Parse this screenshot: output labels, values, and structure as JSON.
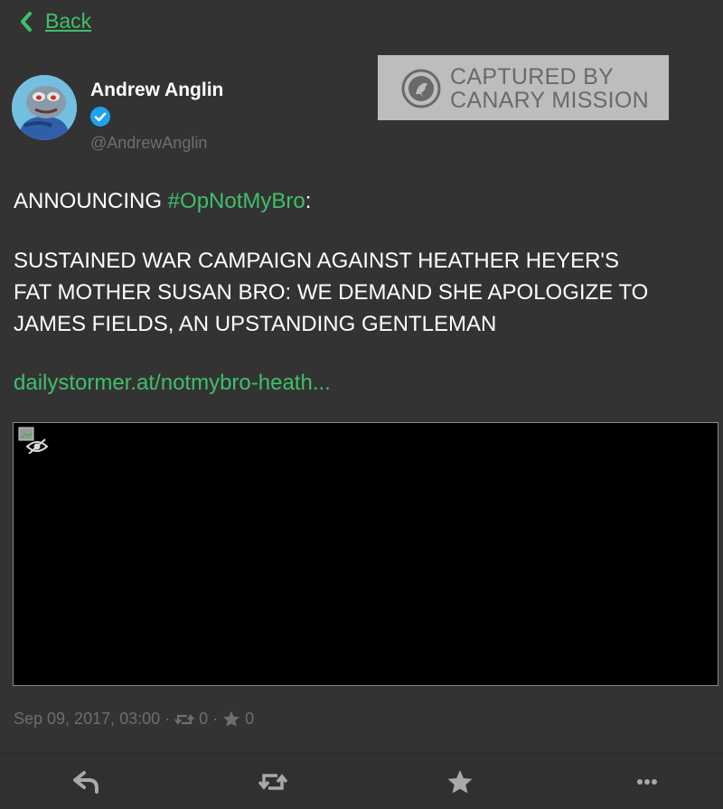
{
  "nav": {
    "back_label": "Back"
  },
  "author": {
    "name": "Andrew Anglin",
    "handle": "@AndrewAnglin",
    "verified": true
  },
  "watermark": {
    "line1": "CAPTURED BY",
    "line2": "CANARY MISSION"
  },
  "tweet": {
    "line1_prefix": "ANNOUNCING ",
    "line1_hashtag": "#OpNotMyBro",
    "line1_suffix": ":",
    "body_lines": [
      "SUSTAINED WAR CAMPAIGN AGAINST HEATHER HEYER'S",
      "FAT MOTHER SUSAN BRO: WE DEMAND SHE APOLOGIZE TO",
      "JAMES FIELDS, AN UPSTANDING GENTLEMAN"
    ],
    "link_text": "dailystormer.at/notmybro-heath..."
  },
  "meta": {
    "timestamp": "Sep 09, 2017, 03:00",
    "separator": "·",
    "retweet_count": "0",
    "favorite_count": "0"
  },
  "actions": {
    "icons": [
      "reply-icon",
      "retweet-icon",
      "favorite-icon",
      "more-icon"
    ]
  },
  "colors": {
    "background": "#333333",
    "accent_green": "#3fbf6b",
    "muted_text": "#6e6e6e",
    "watermark_bg": "#bdbdbd",
    "verified_blue": "#1da1f2"
  }
}
